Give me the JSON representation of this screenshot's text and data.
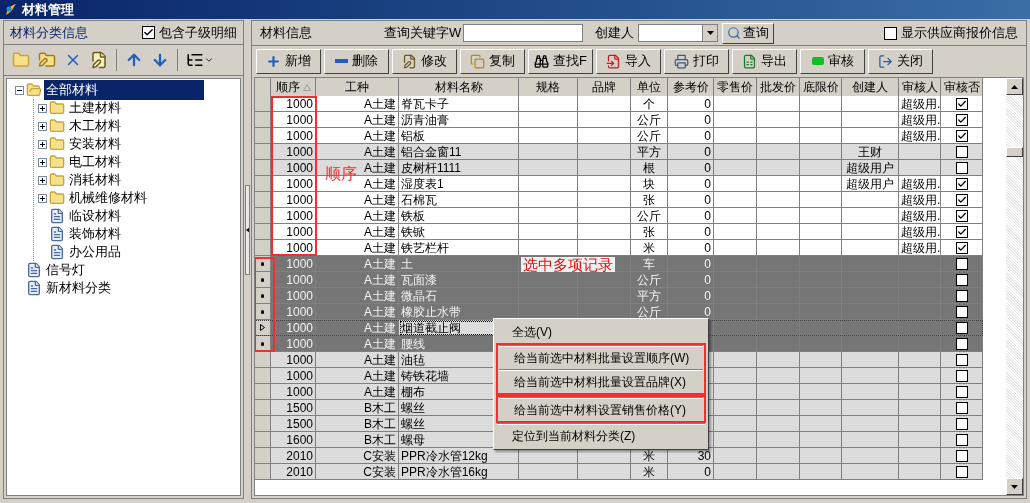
{
  "window": {
    "title": "材料管理"
  },
  "left_panel": {
    "title": "材料分类信息",
    "include_children": {
      "label": "包含子级明细",
      "checked": true
    },
    "tree": [
      {
        "label": "全部材料",
        "kind": "folder",
        "expanded": true,
        "selected": true,
        "children": [
          {
            "label": "土建材料",
            "kind": "folder",
            "expanded": false,
            "selected": false
          },
          {
            "label": "木工材料",
            "kind": "folder",
            "expanded": false,
            "selected": false
          },
          {
            "label": "安装材料",
            "kind": "folder",
            "expanded": false,
            "selected": false
          },
          {
            "label": "电工材料",
            "kind": "folder",
            "expanded": false,
            "selected": false
          },
          {
            "label": "消耗材料",
            "kind": "folder",
            "expanded": false,
            "selected": false
          },
          {
            "label": "机械维修材料",
            "kind": "folder",
            "expanded": false,
            "selected": false
          },
          {
            "label": "临设材料",
            "kind": "leaf",
            "selected": false
          },
          {
            "label": "装饰材料",
            "kind": "leaf",
            "selected": false
          },
          {
            "label": "办公用品",
            "kind": "leaf",
            "selected": false
          }
        ]
      },
      {
        "label": "信号灯",
        "kind": "leaf",
        "selected": false
      },
      {
        "label": "新材料分类",
        "kind": "leaf",
        "selected": false
      }
    ]
  },
  "right_panel": {
    "title": "材料信息",
    "keyword_label": "查询关键字W",
    "creator_label": "创建人",
    "query_button": "查询",
    "supplier_quotes": {
      "label": "显示供应商报价信息",
      "checked": false
    },
    "toolbar": [
      {
        "label": "新增",
        "kind": "add"
      },
      {
        "label": "删除",
        "kind": "delete"
      },
      {
        "label": "修改",
        "kind": "edit"
      },
      {
        "label": "复制",
        "kind": "copy"
      },
      {
        "label": "查找F",
        "kind": "find"
      },
      {
        "label": "导入",
        "kind": "import"
      },
      {
        "label": "打印",
        "kind": "print"
      },
      {
        "label": "导出",
        "kind": "export"
      },
      {
        "label": "审核",
        "kind": "audit"
      },
      {
        "label": "关闭",
        "kind": "close"
      }
    ]
  },
  "table": {
    "columns": [
      {
        "label": "顺序",
        "sorted": true
      },
      {
        "label": "工种",
        "sorted": false
      },
      {
        "label": "材料名称",
        "sorted": false
      },
      {
        "label": "规格",
        "sorted": false
      },
      {
        "label": "品牌",
        "sorted": false
      },
      {
        "label": "单位",
        "sorted": false
      },
      {
        "label": "参考价",
        "sorted": false
      },
      {
        "label": "零售价",
        "sorted": false
      },
      {
        "label": "批发价",
        "sorted": false
      },
      {
        "label": "底限价",
        "sorted": false
      },
      {
        "label": "创建人",
        "sorted": false
      },
      {
        "label": "审核人",
        "sorted": false
      },
      {
        "label": "审核否",
        "sorted": false
      }
    ],
    "rows": [
      {
        "order": "1000",
        "trade": "A土建",
        "name": "脊瓦卡子",
        "unit": "个",
        "ref_price": "0",
        "auditor": "超级用.",
        "audited": true,
        "selected": false,
        "current": false
      },
      {
        "order": "1000",
        "trade": "A土建",
        "name": "沥青油膏",
        "unit": "公斤",
        "ref_price": "0",
        "auditor": "超级用.",
        "audited": true,
        "selected": false,
        "current": false
      },
      {
        "order": "1000",
        "trade": "A土建",
        "name": "铝板",
        "unit": "公斤",
        "ref_price": "0",
        "auditor": "超级用.",
        "audited": true,
        "selected": false,
        "current": false
      },
      {
        "order": "1000",
        "trade": "A土建",
        "name": "铝合金窗11",
        "unit": "平方",
        "ref_price": "0",
        "creator": "王财",
        "audited": false,
        "selected": false,
        "current": false
      },
      {
        "order": "1000",
        "trade": "A土建",
        "name": "皮树杆1111",
        "unit": "根",
        "ref_price": "0",
        "creator": "超级用户",
        "audited": false,
        "selected": false,
        "current": false
      },
      {
        "order": "1000",
        "trade": "A土建",
        "name": "湿度表1",
        "unit": "块",
        "ref_price": "0",
        "creator": "超级用户",
        "auditor": "超级用.",
        "audited": true,
        "selected": false,
        "current": false
      },
      {
        "order": "1000",
        "trade": "A土建",
        "name": "石棉瓦",
        "unit": "张",
        "ref_price": "0",
        "auditor": "超级用.",
        "audited": true,
        "selected": false,
        "current": false
      },
      {
        "order": "1000",
        "trade": "A土建",
        "name": "铁板",
        "unit": "公斤",
        "ref_price": "0",
        "auditor": "超级用.",
        "audited": true,
        "selected": false,
        "current": false
      },
      {
        "order": "1000",
        "trade": "A土建",
        "name": "铁锨",
        "unit": "张",
        "ref_price": "0",
        "auditor": "超级用.",
        "audited": true,
        "selected": false,
        "current": false
      },
      {
        "order": "1000",
        "trade": "A土建",
        "name": "铁艺栏杆",
        "unit": "米",
        "ref_price": "0",
        "auditor": "超级用.",
        "audited": true,
        "selected": false,
        "current": false
      },
      {
        "order": "1000",
        "trade": "A土建",
        "name": "土",
        "unit": "车",
        "ref_price": "0",
        "audited": false,
        "selected": true,
        "current": false
      },
      {
        "order": "1000",
        "trade": "A土建",
        "name": "瓦面漆",
        "unit": "公斤",
        "ref_price": "0",
        "audited": false,
        "selected": true,
        "current": false
      },
      {
        "order": "1000",
        "trade": "A土建",
        "name": "微晶石",
        "unit": "平方",
        "ref_price": "0",
        "audited": false,
        "selected": true,
        "current": false
      },
      {
        "order": "1000",
        "trade": "A土建",
        "name": "橡胶止水带",
        "unit": "公斤",
        "ref_price": "0",
        "audited": false,
        "selected": true,
        "current": false
      },
      {
        "order": "1000",
        "trade": "A土建",
        "name": "烟道截止阀",
        "audited": false,
        "selected": true,
        "current": true
      },
      {
        "order": "1000",
        "trade": "A土建",
        "name": "腰线",
        "audited": false,
        "selected": true,
        "current": false
      },
      {
        "order": "1000",
        "trade": "A土建",
        "name": "油毡",
        "audited": false,
        "selected": false,
        "current": false
      },
      {
        "order": "1000",
        "trade": "A土建",
        "name": "铸铁花墙",
        "audited": false,
        "selected": false,
        "current": false
      },
      {
        "order": "1000",
        "trade": "A土建",
        "name": "棚布",
        "audited": false,
        "selected": false,
        "current": false
      },
      {
        "order": "1500",
        "trade": "B木工",
        "name": "螺丝",
        "audited": false,
        "selected": false,
        "current": false
      },
      {
        "order": "1500",
        "trade": "B木工",
        "name": "螺丝",
        "audited": false,
        "selected": false,
        "current": false
      },
      {
        "order": "1600",
        "trade": "B木工",
        "name": "螺母",
        "audited": false,
        "selected": false,
        "current": false
      },
      {
        "order": "2010",
        "trade": "C安装",
        "name": "PPR冷水管12kg",
        "unit": "米",
        "ref_price": "30",
        "audited": false,
        "selected": false,
        "current": false
      },
      {
        "order": "2010",
        "trade": "C安装",
        "name": "PPR冷水管16kg",
        "unit": "米",
        "ref_price": "0",
        "audited": false,
        "selected": false,
        "current": false
      }
    ]
  },
  "context_menu": {
    "groups": [
      {
        "boxed": false,
        "items": [
          "全选(V)"
        ]
      },
      {
        "boxed": true,
        "items": [
          "给当前选中材料批量设置顺序(W)",
          "给当前选中材料批量设置品牌(X)"
        ]
      },
      {
        "boxed": true,
        "items": [
          "给当前选中材料设置销售价格(Y)"
        ]
      },
      {
        "boxed": false,
        "items": [
          "定位到当前材料分类(Z)"
        ]
      }
    ]
  },
  "annotations": [
    {
      "kind": "order_box",
      "note": "顺序"
    },
    {
      "kind": "selection_box",
      "note": "选中多项记录"
    }
  ]
}
